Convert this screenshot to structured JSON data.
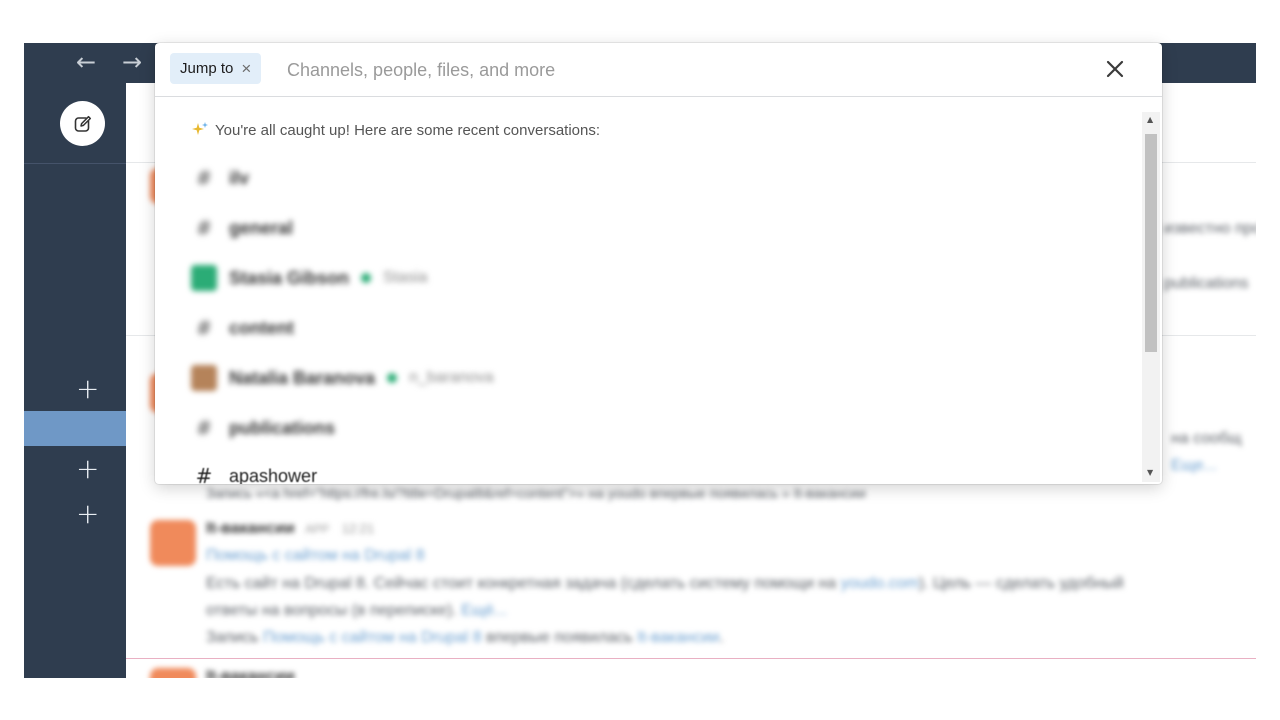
{
  "nav": {
    "back_arrow": "←",
    "forward_arrow": "→"
  },
  "sidebar": {
    "compose_icon": "compose-icon",
    "plus_buttons": [
      "+",
      "+",
      "+"
    ]
  },
  "search": {
    "chip_label": "Jump to",
    "chip_clear": "×",
    "placeholder": "Channels, people, files, and more",
    "value": "",
    "close_label": "✕"
  },
  "recent": {
    "caught_up_text": "You're all caught up! Here are some recent conversations:",
    "items": [
      {
        "type": "channel",
        "prefix": "#",
        "name": "ilv"
      },
      {
        "type": "channel",
        "prefix": "#",
        "name": "general"
      },
      {
        "type": "person",
        "name": "Stasia Gibson",
        "handle": "Stasia",
        "avatar_color": "#2bac76"
      },
      {
        "type": "channel",
        "prefix": "#",
        "name": "content"
      },
      {
        "type": "person",
        "name": "Natalia Baranova",
        "handle": "n_baranova",
        "avatar_color": "#b5835a"
      },
      {
        "type": "channel",
        "prefix": "#",
        "name": "publications"
      },
      {
        "type": "channel",
        "prefix": "#",
        "name": "apashower"
      }
    ]
  },
  "background": {
    "author": "It-вакансии",
    "author_tag": "APP",
    "time": "12:21",
    "link_title": "Помощь с сайтом на Drupal 8",
    "line1": "Есть сайт на Drupal 8. Сейчас стоит конкретная задача (сделать систему помощи на ",
    "line1_link": "youdo.com",
    "line1_tail": "). Цель — сделать удобный",
    "line2": "ответы на вопросы (в переписке). ",
    "line2_link": "Ещё...",
    "line3_prefix": "Запись ",
    "line3_link": "Помощь с сайтом на Drupal 8",
    "line3_mid": " впервые появилась ",
    "line3_link2": "It-вакансии",
    "line3_suffix": ".",
    "top_line": "Запись «<a href=\"https://fre.ls/?title=Drupal8&ref=content\">» на youdo впервые появилась » It-вакансии",
    "snip_right_1": "известно про",
    "snip_right_2": "publications",
    "snip_right_3": "на сообщ",
    "snip_right_4": "Еще..."
  },
  "colors": {
    "sidebar_bg": "#2f3d4f",
    "active_item": "#6f98c6",
    "chip_bg": "#e2eef9",
    "online": "#2bac76",
    "sparkle": "#e8b931"
  }
}
